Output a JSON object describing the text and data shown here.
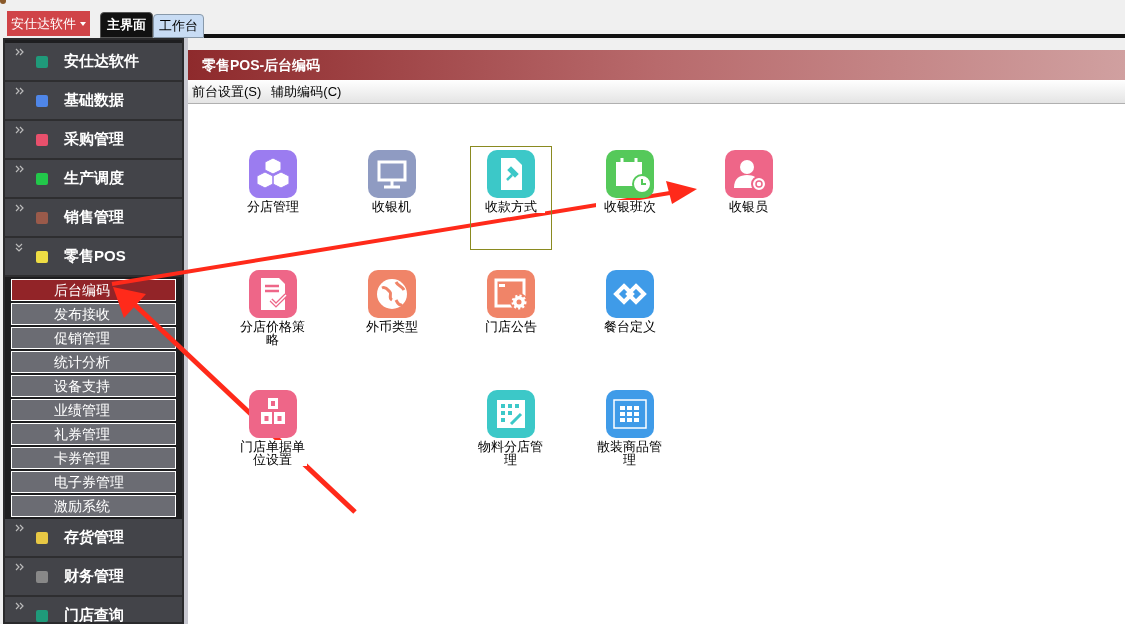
{
  "top_bar": {
    "app_menu": "安仕达软件",
    "tabs": [
      {
        "label": "主界面",
        "selected": true
      },
      {
        "label": "工作台",
        "selected": false
      }
    ]
  },
  "sidebar": {
    "groups": [
      {
        "label": "安仕达软件",
        "expanded": false,
        "color": "#1f9a7a"
      },
      {
        "label": "基础数据",
        "expanded": false,
        "color": "#4f86e8"
      },
      {
        "label": "采购管理",
        "expanded": false,
        "color": "#e8506c"
      },
      {
        "label": "生产调度",
        "expanded": false,
        "color": "#22c84a"
      },
      {
        "label": "销售管理",
        "expanded": false,
        "color": "#9a5a4a"
      },
      {
        "label": "零售POS",
        "expanded": true,
        "color": "#eedd44",
        "children": [
          {
            "label": "后台编码",
            "selected": true
          },
          {
            "label": "发布接收",
            "selected": false
          },
          {
            "label": "促销管理",
            "selected": false
          },
          {
            "label": "统计分析",
            "selected": false
          },
          {
            "label": "设备支持",
            "selected": false
          },
          {
            "label": "业绩管理",
            "selected": false
          },
          {
            "label": "礼券管理",
            "selected": false
          },
          {
            "label": "卡券管理",
            "selected": false
          },
          {
            "label": "电子券管理",
            "selected": false
          },
          {
            "label": "激励系统",
            "selected": false
          }
        ]
      },
      {
        "label": "存货管理",
        "expanded": false,
        "color": "#e8c844"
      },
      {
        "label": "财务管理",
        "expanded": false,
        "color": "#888888"
      },
      {
        "label": "门店查询",
        "expanded": false,
        "color": "#1f9a7a"
      }
    ]
  },
  "panel": {
    "title": "零售POS-后台编码",
    "menu": [
      "前台设置(S)",
      "辅助编码(C)"
    ],
    "rows": [
      [
        {
          "kind": "cubes",
          "label": "分店管理",
          "color": "#9b7cf0",
          "selected": false
        },
        {
          "kind": "monitor",
          "label": "收银机",
          "color": "#8f9bc2",
          "selected": false
        },
        {
          "kind": "pin",
          "label": "收款方式",
          "color": "#3cc8c8",
          "selected": true
        },
        {
          "kind": "calendar",
          "label": "收银班次",
          "color": "#55c95a",
          "selected": false
        },
        {
          "kind": "person",
          "label": "收银员",
          "color": "#ee6688",
          "selected": false
        }
      ],
      [
        {
          "kind": "doc",
          "label": "分店价格策略",
          "color": "#ee6688",
          "selected": false
        },
        {
          "kind": "globe",
          "label": "外币类型",
          "color": "#f08468",
          "selected": false
        },
        {
          "kind": "gear",
          "label": "门店公告",
          "color": "#f08468",
          "selected": false
        },
        {
          "kind": "links",
          "label": "餐台定义",
          "color": "#3f9be8",
          "selected": false
        }
      ],
      [
        {
          "kind": "abc",
          "label": "门店单据单位设置",
          "color": "#ee6688",
          "selected": false
        },
        {
          "kind": "empty"
        },
        {
          "kind": "grid",
          "label": "物料分店管理",
          "color": "#3cc8c8",
          "selected": false
        },
        {
          "kind": "table",
          "label": "散装商品管理",
          "color": "#3f9be8",
          "selected": false
        }
      ]
    ]
  }
}
